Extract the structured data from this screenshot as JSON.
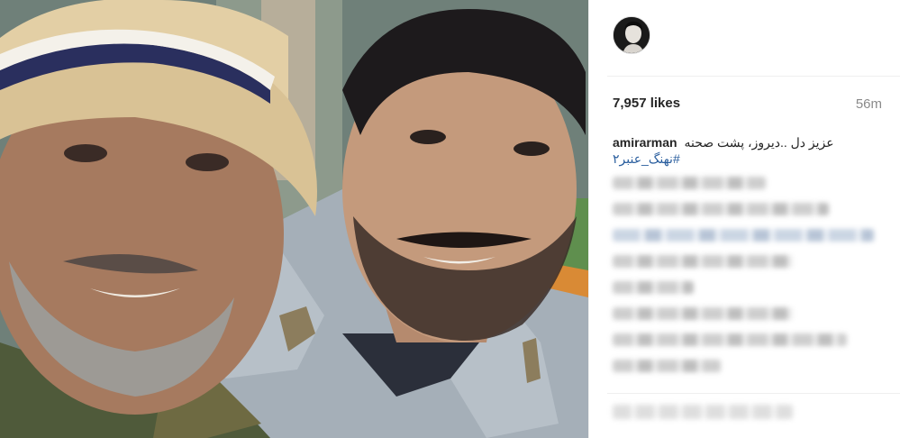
{
  "post": {
    "photo_alt": "selfie",
    "avatar_icon": "profile-avatar-icon",
    "likes": "7,957 likes",
    "time_ago": "56m",
    "caption": {
      "username": "amirarman",
      "text": "عزیز دل ..دیروز، پشت صحنه",
      "hashtag": "#نهنگ_عنبر۲"
    }
  },
  "colors": {
    "hashtag": "#2a5e9e",
    "muted": "#8a8a8a",
    "text": "#262626"
  }
}
